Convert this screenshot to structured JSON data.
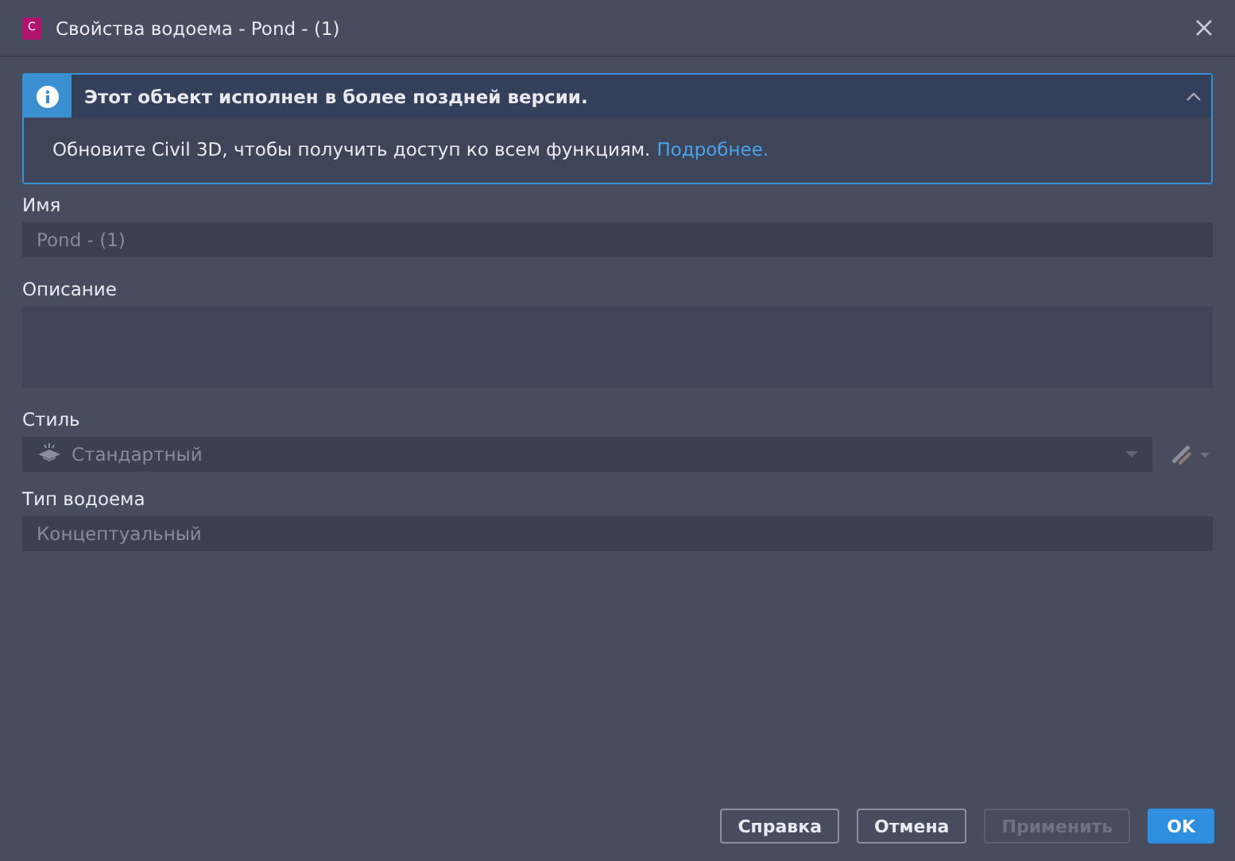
{
  "window": {
    "title": "Свойства водоема - Pond - (1)",
    "logo": "C"
  },
  "banner": {
    "title": "Этот объект исполнен в более поздней версии.",
    "expanded": true,
    "message": "Обновите Civil 3D, чтобы получить доступ ко всем функциям.",
    "link": "Подробнее."
  },
  "fields": [
    {
      "kind": "text",
      "label": "Имя",
      "value": "Pond - (1)",
      "disabled": true
    },
    {
      "kind": "textarea",
      "label": "Описание"
    },
    {
      "kind": "dropdown",
      "label": "Стиль",
      "value": "Стандартный",
      "disabled": true
    },
    {
      "kind": "text",
      "label": "Тип водоема",
      "value": "Концептуальный",
      "disabled": true
    }
  ],
  "buttons": [
    {
      "label": "Справка",
      "kind": "normal",
      "disabled": false
    },
    {
      "label": "Отмена",
      "kind": "normal",
      "disabled": false
    },
    {
      "label": "Применить",
      "kind": "normal",
      "disabled": true
    },
    {
      "label": "OK",
      "kind": "primary",
      "disabled": false
    }
  ]
}
